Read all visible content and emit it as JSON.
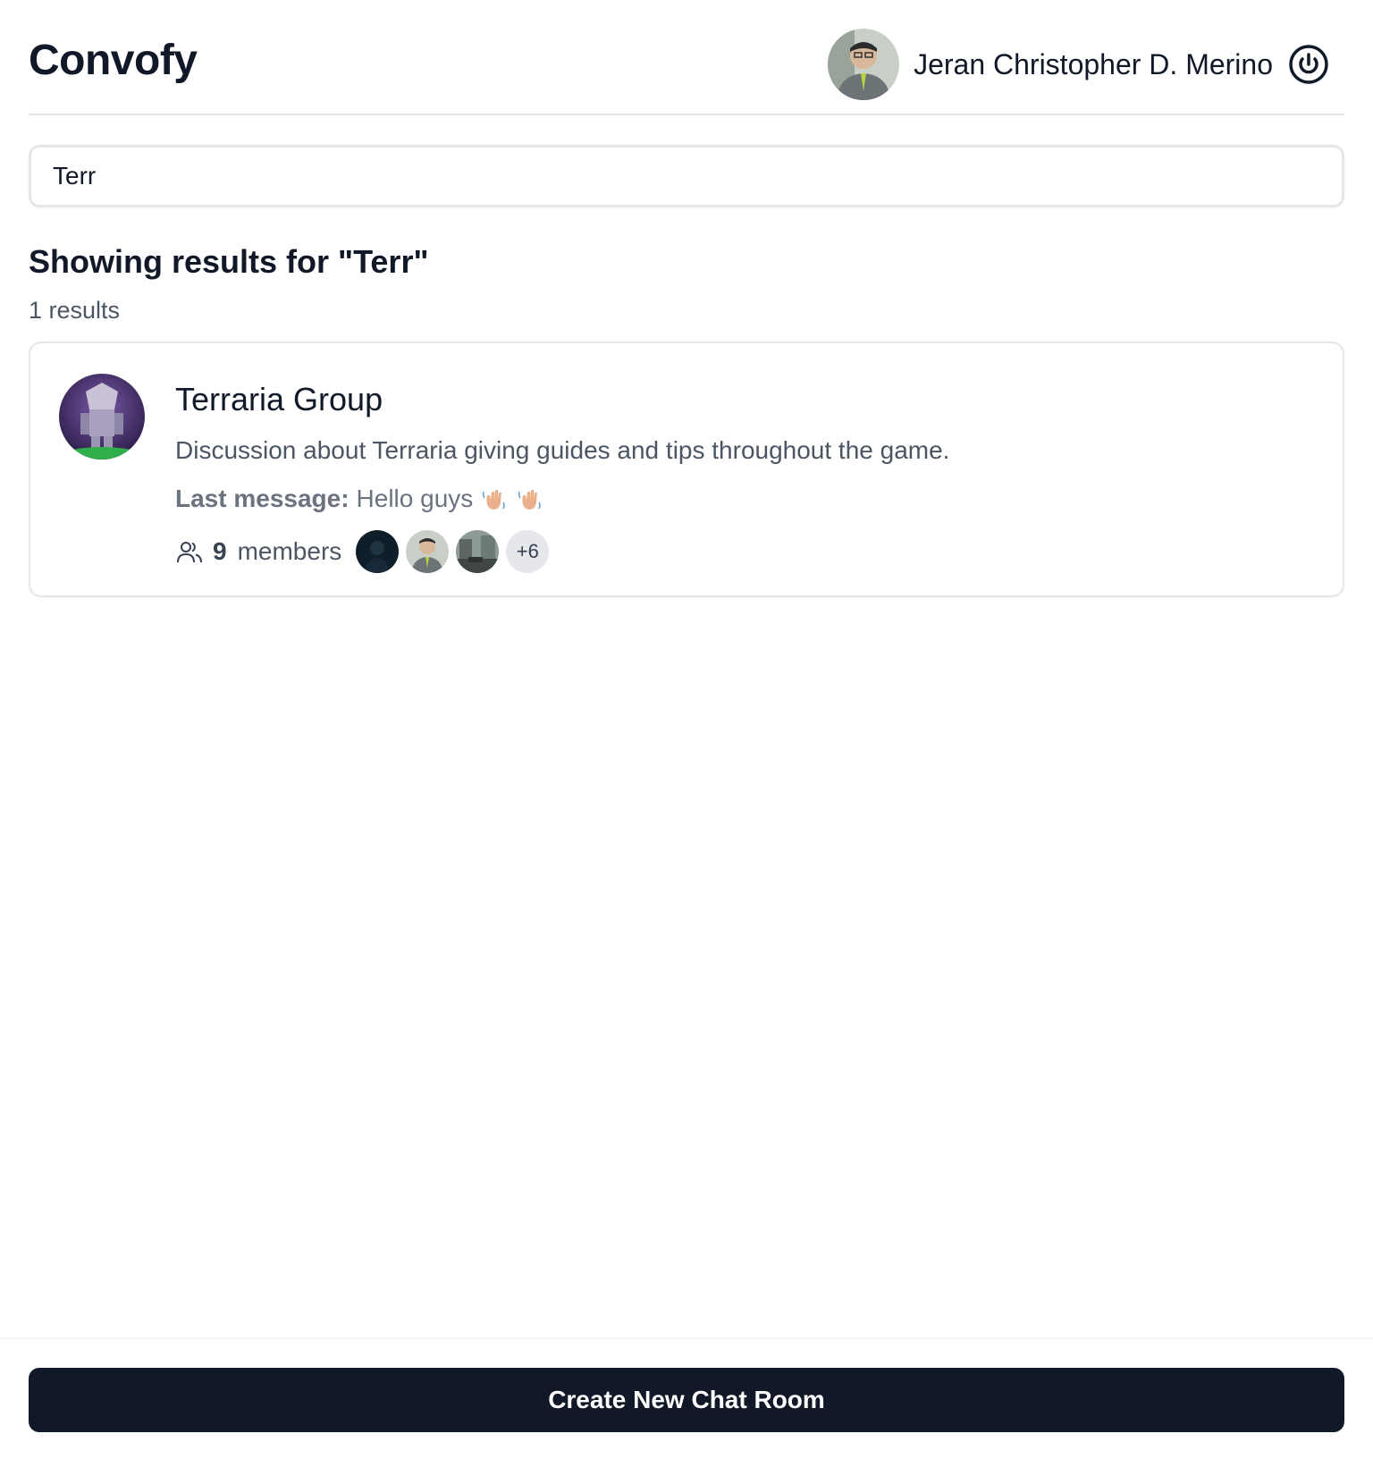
{
  "app": {
    "brand": "Convofy"
  },
  "user": {
    "name": "Jeran Christopher D. Merino",
    "avatar_icon": "user-avatar-photo",
    "logout_icon": "power-icon"
  },
  "search": {
    "value": "Terr",
    "placeholder": ""
  },
  "results": {
    "heading": "Showing results for \"Terr\"",
    "count_text": "1 results",
    "items": [
      {
        "title": "Terraria Group",
        "description": "Discussion about Terraria giving guides and tips throughout the game.",
        "last_message_label": "Last message:",
        "last_message_text": "Hello guys",
        "last_message_emoji": [
          "waving-hand",
          "waving-hand"
        ],
        "member_count": "9",
        "member_word": "members",
        "member_avatars": [
          "dark-avatar",
          "user-avatar-photo",
          "street-photo-avatar"
        ],
        "more_members": "+6"
      }
    ]
  },
  "footer": {
    "create_label": "Create New Chat Room"
  },
  "colors": {
    "primary_dark": "#111827",
    "border": "#e5e7eb",
    "muted_text": "#4b5563"
  }
}
